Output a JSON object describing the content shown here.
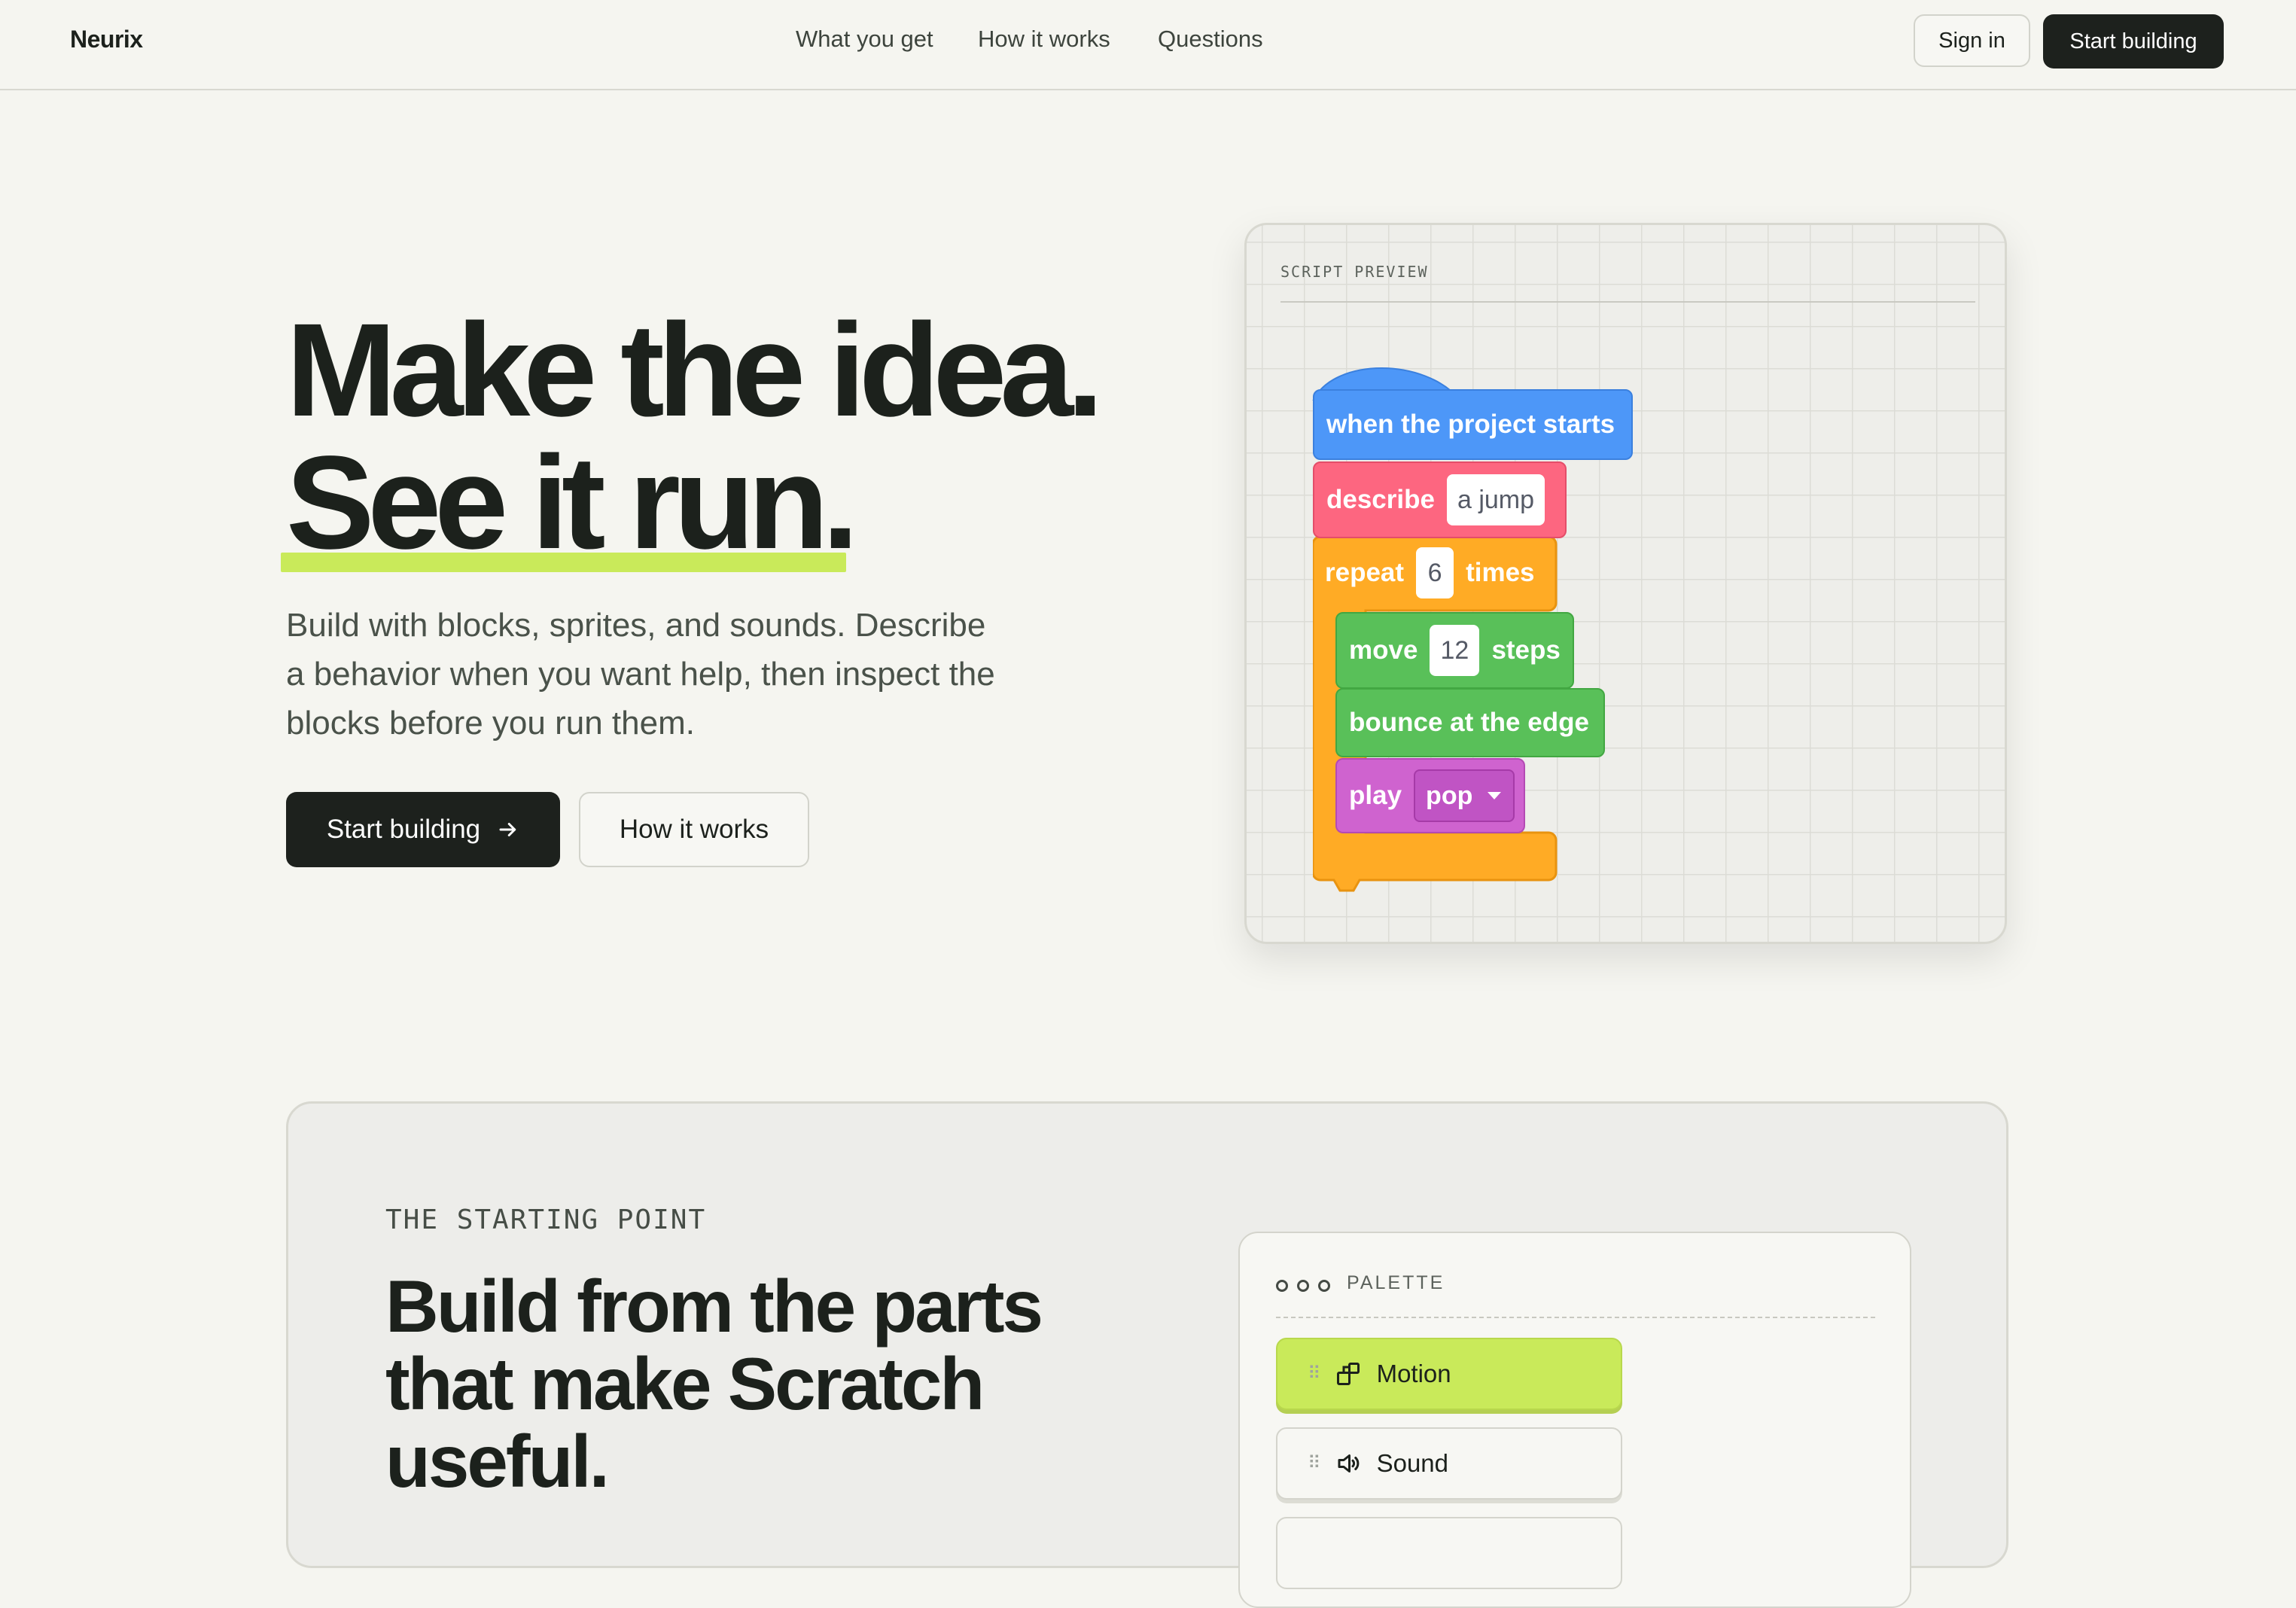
{
  "header": {
    "brand": "Neurix",
    "nav": [
      "What you get",
      "How it works",
      "Questions"
    ],
    "sign_in": "Sign in",
    "start_building": "Start building"
  },
  "hero": {
    "title_line1": "Make the idea.",
    "title_line2": "See it run.",
    "body": "Build with blocks, sprites, and sounds. Describe a behavior when you want help, then inspect the blocks before you run them.",
    "primary_cta": "Start building",
    "secondary_cta": "How it works",
    "accent_color": "#c9ea5a"
  },
  "preview": {
    "label": "SCRIPT PREVIEW",
    "blocks": {
      "hat": "when the project starts",
      "describe": "describe",
      "describe_value": "a jump",
      "repeat": "repeat",
      "repeat_count": "6",
      "repeat_suffix": "times",
      "move": "move",
      "move_value": "12",
      "move_suffix": "steps",
      "bounce": "bounce at the edge",
      "play": "play",
      "play_sound": "pop"
    }
  },
  "starting_point": {
    "eyebrow": "THE STARTING POINT",
    "title": "Build from the parts that make Scratch useful.",
    "palette": {
      "label": "PALETTE",
      "items": [
        {
          "label": "Motion",
          "icon": "blocks-icon"
        },
        {
          "label": "Sound",
          "icon": "speaker-icon"
        }
      ]
    }
  }
}
